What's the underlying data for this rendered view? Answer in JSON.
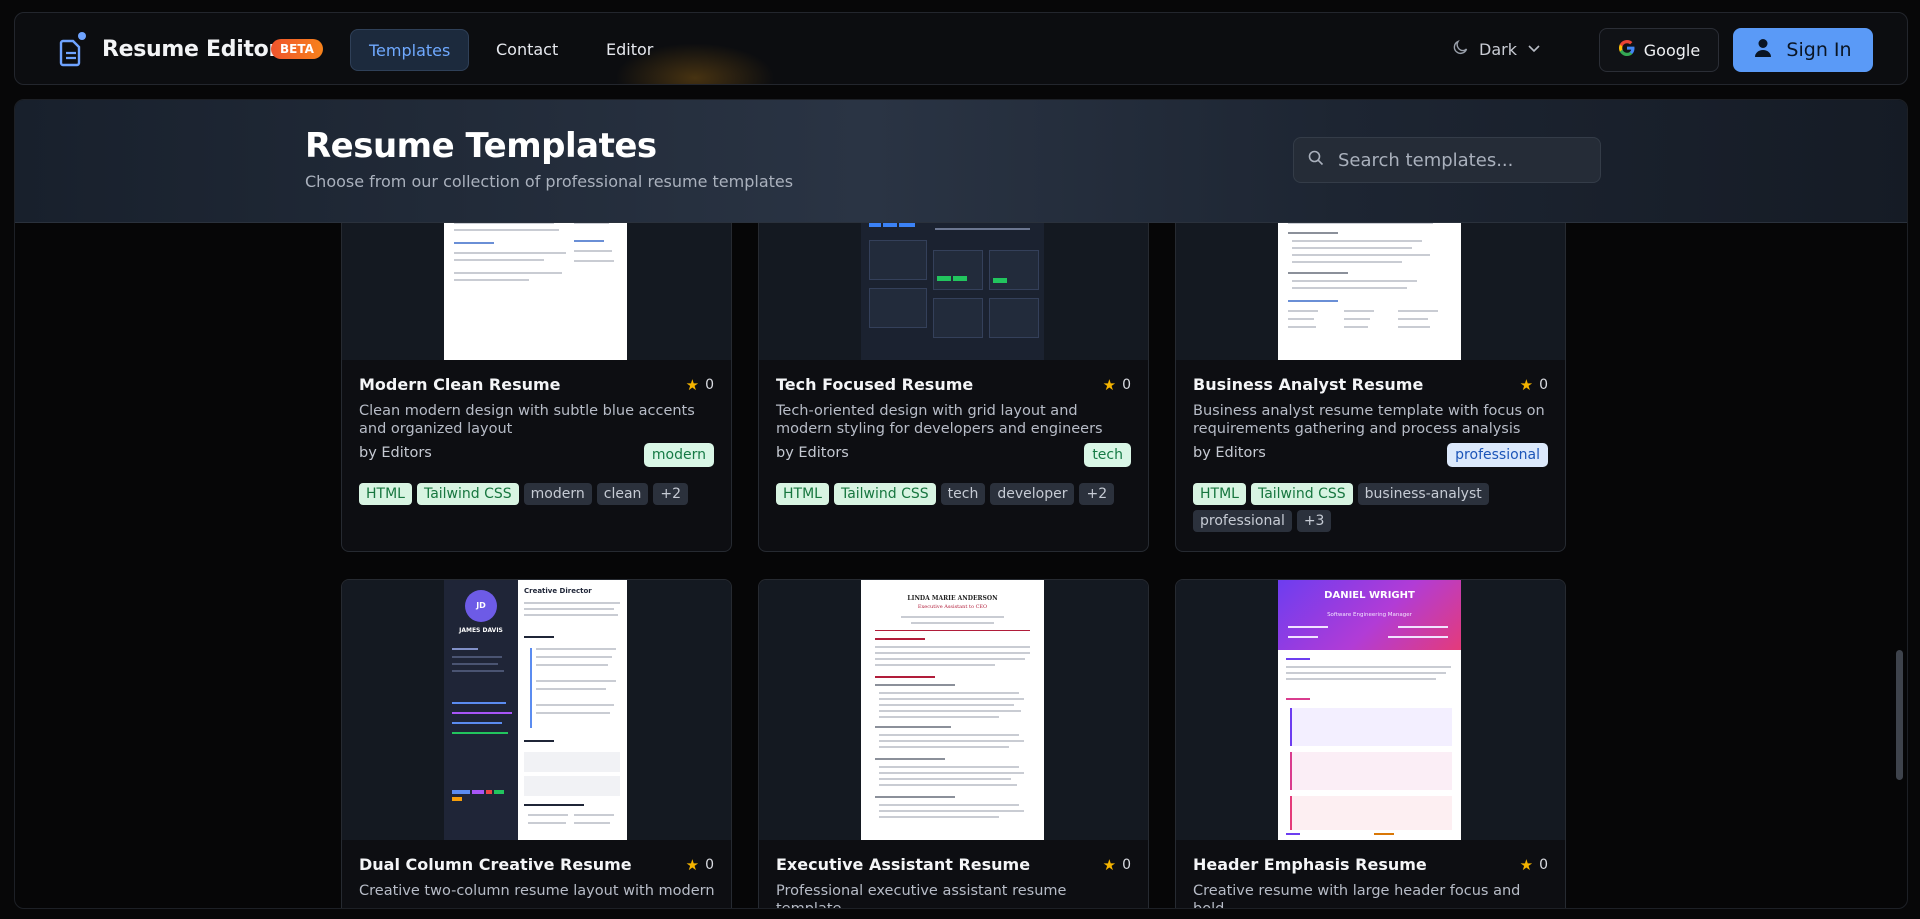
{
  "app": {
    "title": "Resume Editor",
    "badge": "BETA"
  },
  "nav": {
    "tabs": [
      "Templates",
      "Contact",
      "Editor"
    ],
    "active": "Templates",
    "theme_label": "Dark",
    "google_label": "Google",
    "signin_label": "Sign In"
  },
  "hero": {
    "title": "Resume Templates",
    "subtitle": "Choose from our collection of professional resume templates",
    "search_placeholder": "Search templates..."
  },
  "cards": [
    {
      "title": "Modern Clean Resume",
      "rating": "0",
      "description": "Clean modern design with subtle blue accents and organized layout",
      "author": "by Editors",
      "category": "modern",
      "tags": [
        "HTML",
        "Tailwind CSS",
        "modern",
        "clean",
        "+2"
      ]
    },
    {
      "title": "Tech Focused Resume",
      "rating": "0",
      "description": "Tech-oriented design with grid layout and modern styling for developers and engineers",
      "author": "by Editors",
      "category": "tech",
      "tags": [
        "HTML",
        "Tailwind CSS",
        "tech",
        "developer",
        "+2"
      ]
    },
    {
      "title": "Business Analyst Resume",
      "rating": "0",
      "description": "Business analyst resume template with focus on requirements gathering and process analysis",
      "author": "by Editors",
      "category": "professional",
      "tags": [
        "HTML",
        "Tailwind CSS",
        "business-analyst",
        "professional",
        "+3"
      ]
    },
    {
      "title": "Dual Column Creative Resume",
      "rating": "0",
      "description": "Creative two-column resume layout with modern"
    },
    {
      "title": "Executive Assistant Resume",
      "rating": "0",
      "description": "Professional executive assistant resume template"
    },
    {
      "title": "Header Emphasis Resume",
      "rating": "0",
      "description": "Creative resume with large header focus and bold"
    }
  ],
  "previews": {
    "dual_name": "JAMES DAVIS",
    "dual_initials": "JD",
    "dual_role": "Creative Director",
    "exec_name": "LINDA MARIE ANDERSON",
    "exec_role": "Executive Assistant to CEO",
    "header_name": "DANIEL WRIGHT",
    "header_role": "Software Engineering Manager"
  },
  "colors": {
    "accent": "#5a9af7",
    "active_tab_text": "#6fa9ff",
    "beta_badge": "#f0542d",
    "star": "#f5b400",
    "tag_green_bg": "#d8f4e2"
  },
  "icons": {
    "logo": "document-icon",
    "theme": "moon-icon",
    "dropdown": "chevron-down-icon",
    "google": "google-icon",
    "signin": "user-icon",
    "search": "search-icon",
    "rating": "star-icon"
  }
}
